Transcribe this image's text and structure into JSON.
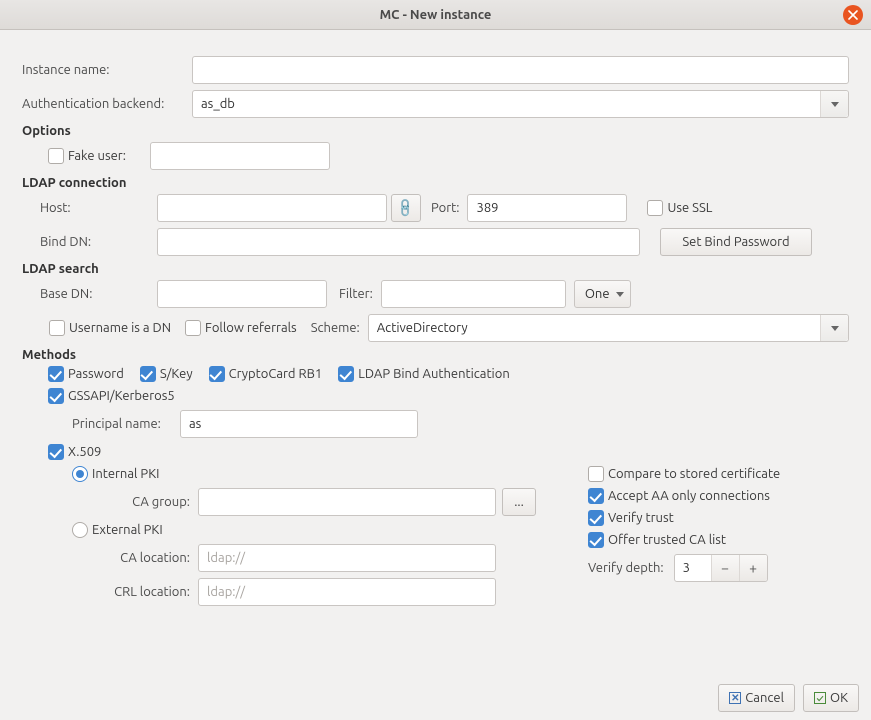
{
  "window": {
    "title": "MC - New instance"
  },
  "instance": {
    "label": "Instance name:",
    "value": ""
  },
  "auth": {
    "label": "Authentication backend:",
    "value": "as_db"
  },
  "options": {
    "heading": "Options",
    "fake_user": {
      "label": "Fake user:",
      "checked": false,
      "value": ""
    }
  },
  "ldap_conn": {
    "heading": "LDAP connection",
    "host": {
      "label": "Host:",
      "value": ""
    },
    "port": {
      "label": "Port:",
      "value": "389"
    },
    "use_ssl": {
      "label": "Use SSL",
      "checked": false
    },
    "bind_dn": {
      "label": "Bind DN:",
      "value": ""
    },
    "bind_pw_btn": "Set Bind Password"
  },
  "ldap_search": {
    "heading": "LDAP search",
    "base_dn": {
      "label": "Base DN:",
      "value": ""
    },
    "filter": {
      "label": "Filter:",
      "value": ""
    },
    "scope": {
      "value": "One"
    },
    "username_is_dn": {
      "label": "Username is a DN",
      "checked": false
    },
    "follow_referrals": {
      "label": "Follow referrals",
      "checked": false
    },
    "scheme": {
      "label": "Scheme:",
      "value": "ActiveDirectory"
    }
  },
  "methods": {
    "heading": "Methods",
    "password": {
      "label": "Password",
      "checked": true
    },
    "skey": {
      "label": "S/Key",
      "checked": true
    },
    "cryptocard": {
      "label": "CryptoCard RB1",
      "checked": true
    },
    "ldap_bind_auth": {
      "label": "LDAP Bind Authentication",
      "checked": true
    },
    "gssapi": {
      "label": "GSSAPI/Kerberos5",
      "checked": true
    },
    "principal": {
      "label": "Principal name:",
      "value": "as"
    },
    "x509": {
      "label": "X.509",
      "checked": true,
      "pki_mode": "internal",
      "internal_label": "Internal PKI",
      "external_label": "External PKI",
      "ca_group": {
        "label": "CA group:",
        "value": "",
        "browse": "..."
      },
      "ca_location": {
        "label": "CA location:",
        "value": "ldap://"
      },
      "crl_location": {
        "label": "CRL location:",
        "value": "ldap://"
      },
      "compare_stored": {
        "label": "Compare to stored certificate",
        "checked": false
      },
      "accept_aa": {
        "label": "Accept AA only connections",
        "checked": true
      },
      "verify_trust": {
        "label": "Verify trust",
        "checked": true
      },
      "offer_trusted": {
        "label": "Offer trusted CA list",
        "checked": true
      },
      "verify_depth": {
        "label": "Verify depth:",
        "value": "3"
      }
    }
  },
  "footer": {
    "cancel": "Cancel",
    "ok": "OK"
  }
}
